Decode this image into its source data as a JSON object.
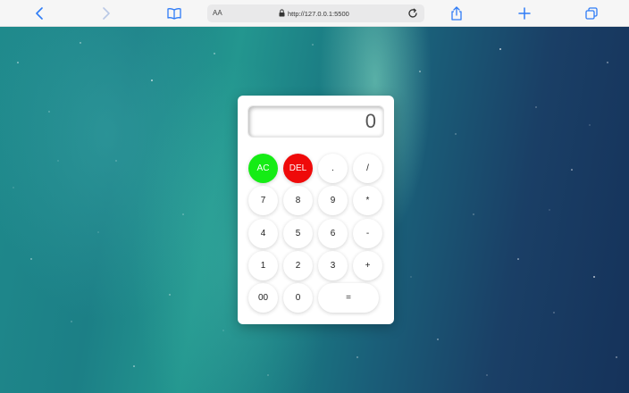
{
  "browser": {
    "text_size_label": "AA",
    "url": "http://127.0.0.1:5500",
    "accent": "#2f7cf6"
  },
  "calculator": {
    "display_value": "0",
    "keys": {
      "ac": "AC",
      "del": "DEL",
      "dot": ".",
      "divide": "/",
      "seven": "7",
      "eight": "8",
      "nine": "9",
      "multiply": "*",
      "four": "4",
      "five": "5",
      "six": "6",
      "minus": "-",
      "one": "1",
      "two": "2",
      "three": "3",
      "plus": "+",
      "double_zero": "00",
      "zero": "0",
      "equals": "="
    },
    "colors": {
      "ac": "#15ec15",
      "del": "#ef0a0a"
    }
  }
}
